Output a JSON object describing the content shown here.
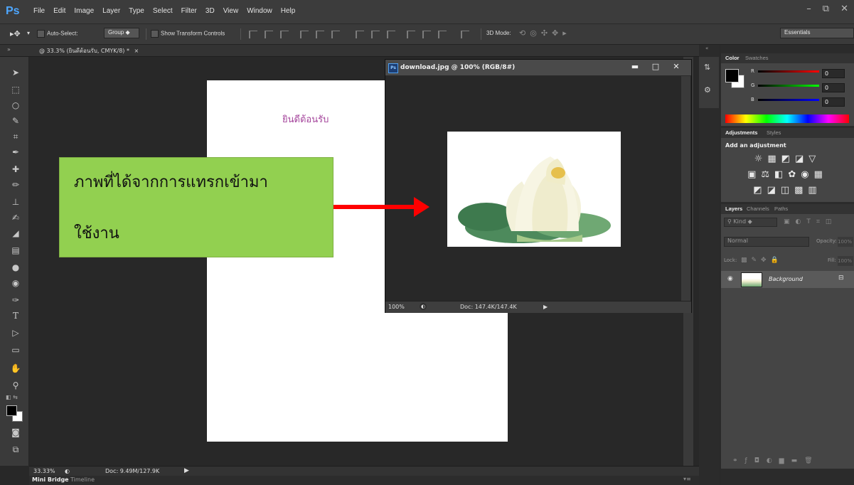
{
  "app": {
    "logo": "Ps"
  },
  "menu": [
    "File",
    "Edit",
    "Image",
    "Layer",
    "Type",
    "Select",
    "Filter",
    "3D",
    "View",
    "Window",
    "Help"
  ],
  "window_controls": {
    "minimize": "–",
    "maximize": "⧉",
    "close": "✕"
  },
  "options_bar": {
    "auto_select_label": "Auto-Select:",
    "group_value": "Group",
    "show_transform_label": "Show Transform Controls",
    "mode_label": "3D Mode:",
    "workspace": "Essentials"
  },
  "document_tab": "@ 33.3% (ยินดีต้อนรับ, CMYK/8) *",
  "document": {
    "welcome_text": "ยินดีต้อนรับ",
    "callout_line1": "ภาพที่ได้จากการแทรกเข้ามา",
    "callout_line2": "ใช้งาน",
    "colors": {
      "callout_bg": "#92d050",
      "welcome": "#a4449b",
      "arrow": "#ff0000"
    }
  },
  "float_window": {
    "title": "download.jpg @ 100% (RGB/8#)",
    "zoom": "100%",
    "doc_size": "Doc: 147.4K/147.4K"
  },
  "status_bar": {
    "zoom": "33.33%",
    "doc_size": "Doc: 9.49M/127.9K"
  },
  "bottom_tabs": [
    "Mini Bridge",
    "Timeline"
  ],
  "color_panel": {
    "tabs": [
      "Color",
      "Swatches"
    ],
    "channels": [
      {
        "label": "R",
        "value": "0"
      },
      {
        "label": "G",
        "value": "0"
      },
      {
        "label": "B",
        "value": "0"
      }
    ]
  },
  "adjustments_panel": {
    "tabs": [
      "Adjustments",
      "Styles"
    ],
    "heading": "Add an adjustment"
  },
  "layers_panel": {
    "tabs": [
      "Layers",
      "Channels",
      "Paths"
    ],
    "kind_label": "Kind",
    "blend_mode": "Normal",
    "opacity_label": "Opacity:",
    "opacity_value": "100%",
    "lock_label": "Lock:",
    "fill_label": "Fill:",
    "fill_value": "100%",
    "layer_name": "Background"
  }
}
